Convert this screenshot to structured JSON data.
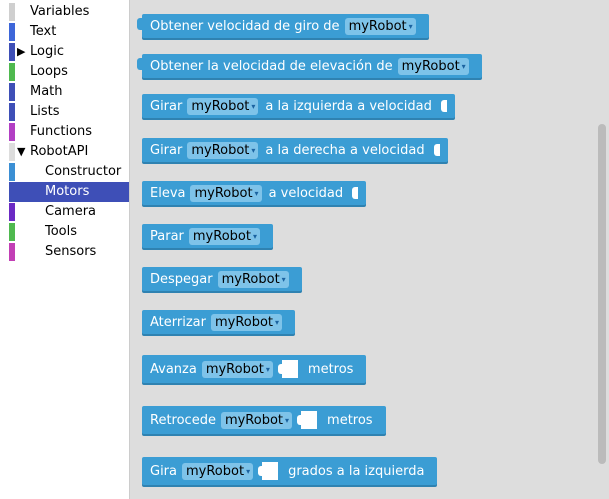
{
  "toolbox": {
    "categories": [
      {
        "label": "Variables",
        "color": "#cfcfcf"
      },
      {
        "label": "Text",
        "color": "#3d66d9"
      },
      {
        "label": "Logic",
        "color": "#3e4fb7"
      },
      {
        "label": "Loops",
        "color": "#4fb94f"
      },
      {
        "label": "Math",
        "color": "#3e4fb7"
      },
      {
        "label": "Lists",
        "color": "#3e4fb7"
      },
      {
        "label": "Functions",
        "color": "#b23fc4"
      },
      {
        "label": "RobotAPI",
        "color": "#dddddd"
      },
      {
        "label": "Constructor",
        "color": "#3b8fd4"
      },
      {
        "label": "Motors",
        "color": "#3e4fb7"
      },
      {
        "label": "Camera",
        "color": "#6b2ac4"
      },
      {
        "label": "Tools",
        "color": "#4fb94f"
      },
      {
        "label": "Sensors",
        "color": "#c23fb5"
      }
    ],
    "expand_arrow": "▶",
    "collapse_arrow": "▼",
    "selected": "Motors"
  },
  "robot_var": "myRobot",
  "caret": "▾",
  "blocks": [
    {
      "text": "Obtener velocidad de giro de"
    },
    {
      "text": "Obtener la velocidad de elevación de"
    },
    {
      "text": "Girar",
      "after": "a la izquierda a velocidad"
    },
    {
      "text": "Girar",
      "after": "a la derecha a velocidad"
    },
    {
      "text": "Eleva",
      "after": "a velocidad"
    },
    {
      "text": "Parar"
    },
    {
      "text": "Despegar"
    },
    {
      "text": "Aterrizar"
    },
    {
      "text": "Avanza",
      "after": "metros"
    },
    {
      "text": "Retrocede",
      "after": "metros"
    },
    {
      "text": "Gira",
      "after": "grados a la izquierda"
    }
  ]
}
